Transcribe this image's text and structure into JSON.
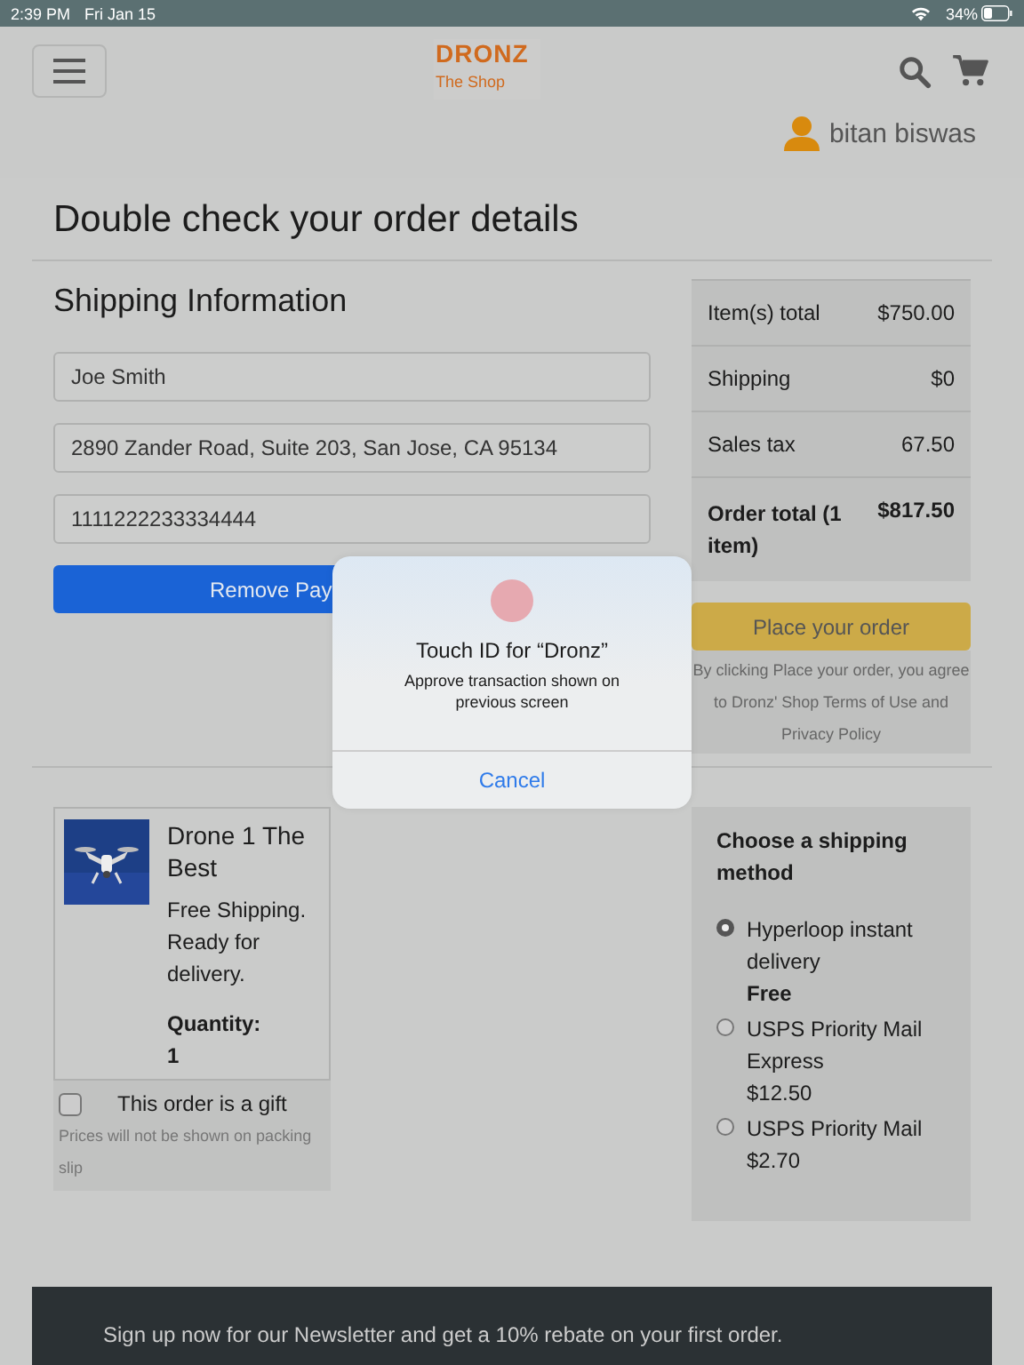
{
  "status_bar": {
    "time": "2:39 PM",
    "date": "Fri Jan 15",
    "battery": "34%"
  },
  "header": {
    "logo_title": "DRONZ",
    "logo_subtitle": "The Shop",
    "user": "bitan biswas"
  },
  "page_title": "Double check your order details",
  "shipping": {
    "heading": "Shipping Information",
    "fields": [
      {
        "value": "Joe Smith"
      },
      {
        "value": "2890 Zander Road, Suite 203, San Jose, CA 95134"
      },
      {
        "value": "1111222233334444"
      }
    ],
    "button": "Remove Pay"
  },
  "summary": {
    "rows": [
      {
        "label": "Item(s) total",
        "value": "$750.00",
        "kind": "normal"
      },
      {
        "label": "Shipping",
        "value": "$0",
        "kind": "normal"
      },
      {
        "label": "Sales tax",
        "value": "67.50",
        "kind": "normal"
      },
      {
        "label": "Order total (1 item)",
        "value": "$817.50",
        "kind": "total"
      }
    ],
    "button": "Place your order",
    "note": "By clicking Place your order, you agree to Dronz' Shop Terms of Use and Privacy Policy"
  },
  "item": {
    "name": "Drone 1 The Best",
    "description": "Free Shipping. Ready for delivery.",
    "quantity_label": "Quantity:",
    "quantity": "1"
  },
  "gift": {
    "label": "This order is a gift",
    "checked": false,
    "note": "Prices will not be shown on packing slip"
  },
  "shipping_method": {
    "heading": "Choose a shipping method",
    "options": [
      {
        "name": "Hyperloop instant delivery",
        "price": "Free",
        "selected": true
      },
      {
        "name": "USPS Priority Mail Express",
        "price": "$12.50",
        "selected": false
      },
      {
        "name": "USPS Priority Mail",
        "price": "$2.70",
        "selected": false
      }
    ]
  },
  "dialog": {
    "title": "Touch ID for “Dronz”",
    "message": "Approve transaction shown on previous screen",
    "button": "Cancel"
  },
  "footer": {
    "text": "Sign up now for our Newsletter and get a 10% rebate on your first order."
  }
}
